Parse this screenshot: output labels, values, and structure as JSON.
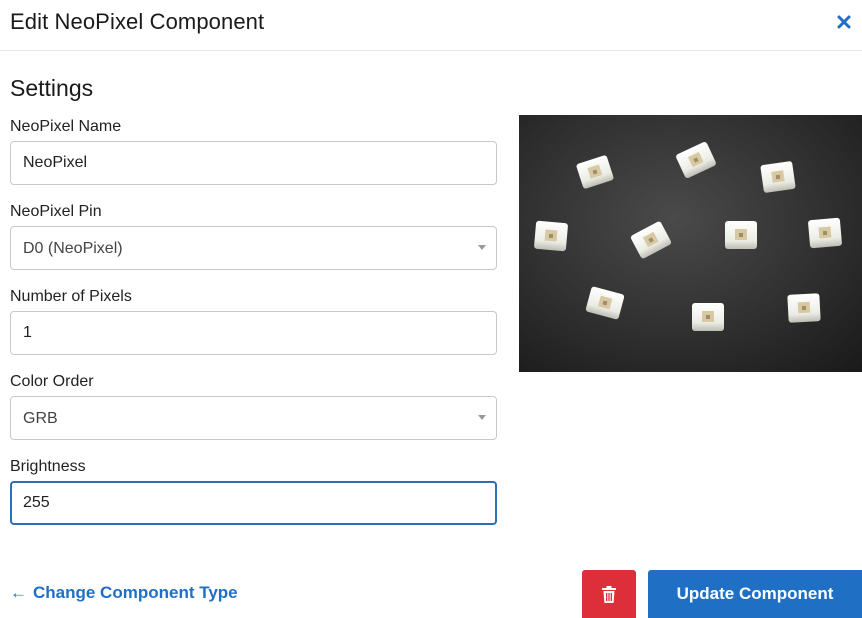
{
  "modal": {
    "title": "Edit NeoPixel Component",
    "close_icon": "close-icon"
  },
  "settings": {
    "heading": "Settings",
    "name_label": "NeoPixel Name",
    "name_value": "NeoPixel",
    "pin_label": "NeoPixel Pin",
    "pin_value": "D0 (NeoPixel)",
    "pixels_label": "Number of Pixels",
    "pixels_value": "1",
    "color_order_label": "Color Order",
    "color_order_value": "GRB",
    "brightness_label": "Brightness",
    "brightness_value": "255"
  },
  "image": {
    "subject": "neopixel-leds-photo"
  },
  "footer": {
    "back_arrow": "←",
    "back_label": "Change Component Type",
    "delete_icon": "trash-icon",
    "update_label": "Update Component"
  },
  "colors": {
    "accent": "#1f6fc5",
    "danger": "#dc2f3a",
    "focus_border": "#2c6fb8"
  }
}
